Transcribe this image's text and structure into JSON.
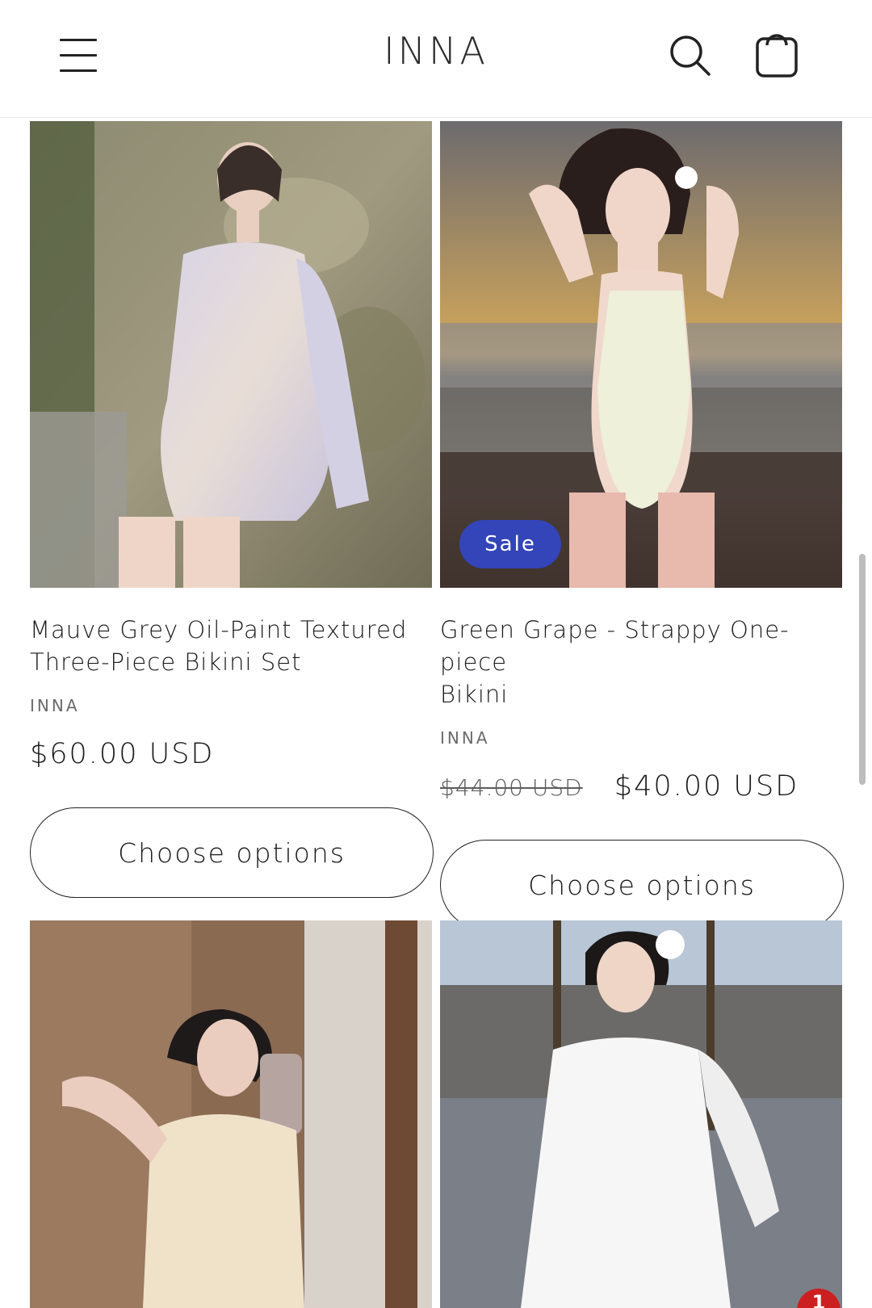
{
  "header": {
    "logo": "INNA",
    "menu_icon": "hamburger-menu-icon",
    "search_icon": "search-icon",
    "cart_icon": "cart-icon"
  },
  "products": [
    {
      "title_line1": "Mauve Grey Oil-Paint Textured",
      "title_line2": "Three-Piece Bikini Set",
      "vendor": "INNA",
      "price": "$60.00 USD",
      "button": "Choose options"
    },
    {
      "title_line1": "Green Grape - Strappy One-piece",
      "title_line2": "Bikini",
      "vendor": "INNA",
      "compare_price": "$44.00 USD",
      "price": "$40.00 USD",
      "badge": "Sale",
      "button": "Choose options"
    }
  ],
  "notification": {
    "count": "1"
  },
  "colors": {
    "sale_badge": "#3345b8",
    "notification": "#cc1f1f"
  }
}
